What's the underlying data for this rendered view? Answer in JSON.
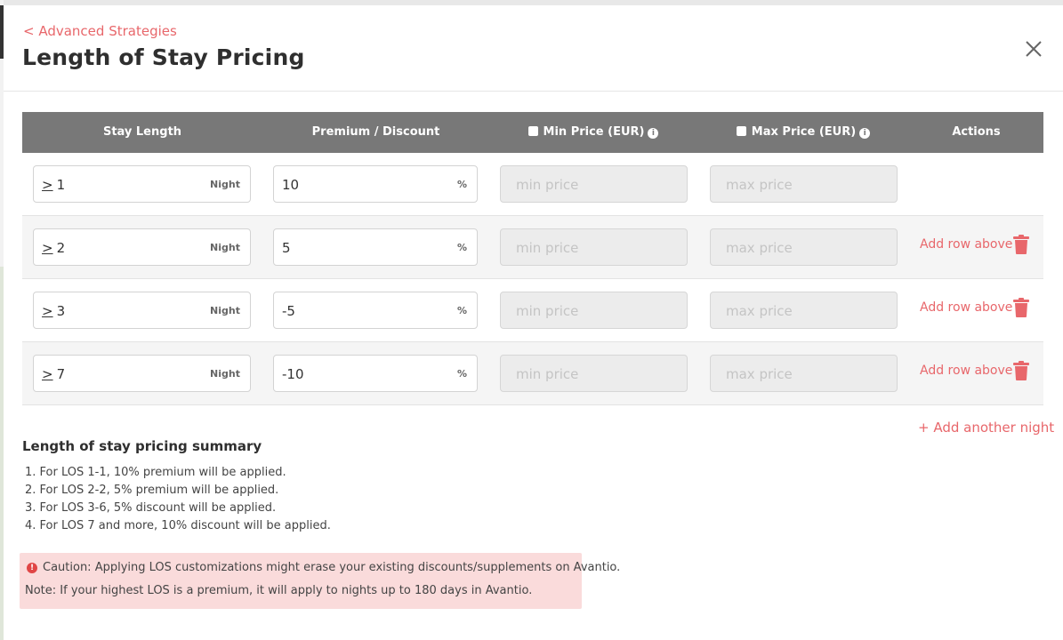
{
  "header": {
    "back_label": "< Advanced Strategies",
    "title": "Length of Stay Pricing",
    "close_icon": "close-icon"
  },
  "table": {
    "columns": {
      "stay_length": "Stay Length",
      "premium_discount": "Premium / Discount",
      "min_price": "Min Price (EUR)",
      "max_price": "Max Price (EUR)",
      "actions": "Actions"
    },
    "rows": [
      {
        "ge": ">",
        "nights": "1",
        "night_unit": "Night",
        "premium": "10",
        "percent_unit": "%",
        "min_placeholder": "min price",
        "max_placeholder": "max price"
      },
      {
        "ge": ">",
        "nights": "2",
        "night_unit": "Night",
        "premium": "5",
        "percent_unit": "%",
        "min_placeholder": "min price",
        "max_placeholder": "max price",
        "add_above": "Add row above"
      },
      {
        "ge": ">",
        "nights": "3",
        "night_unit": "Night",
        "premium": "-5",
        "percent_unit": "%",
        "min_placeholder": "min price",
        "max_placeholder": "max price",
        "add_above": "Add row above"
      },
      {
        "ge": ">",
        "nights": "7",
        "night_unit": "Night",
        "premium": "-10",
        "percent_unit": "%",
        "min_placeholder": "min price",
        "max_placeholder": "max price",
        "add_above": "Add row above"
      }
    ],
    "add_another_night": "+ Add another night"
  },
  "summary": {
    "title": "Length of stay pricing summary",
    "items": [
      "1. For LOS 1-1, 10% premium will be applied.",
      "2. For LOS 2-2, 5% premium will be applied.",
      "3. For LOS 3-6, 5% discount will be applied.",
      "4. For LOS 7 and more, 10% discount will be applied."
    ]
  },
  "caution": {
    "caution_text": "Caution: Applying LOS customizations might erase your existing discounts/supplements on Avantio.",
    "note_text": "Note: If your highest LOS is a premium, it will apply to nights up to 180 days in Avantio."
  },
  "colors": {
    "accent": "#e8676b",
    "table_header": "#787878",
    "caution_bg": "#fadbdb"
  }
}
